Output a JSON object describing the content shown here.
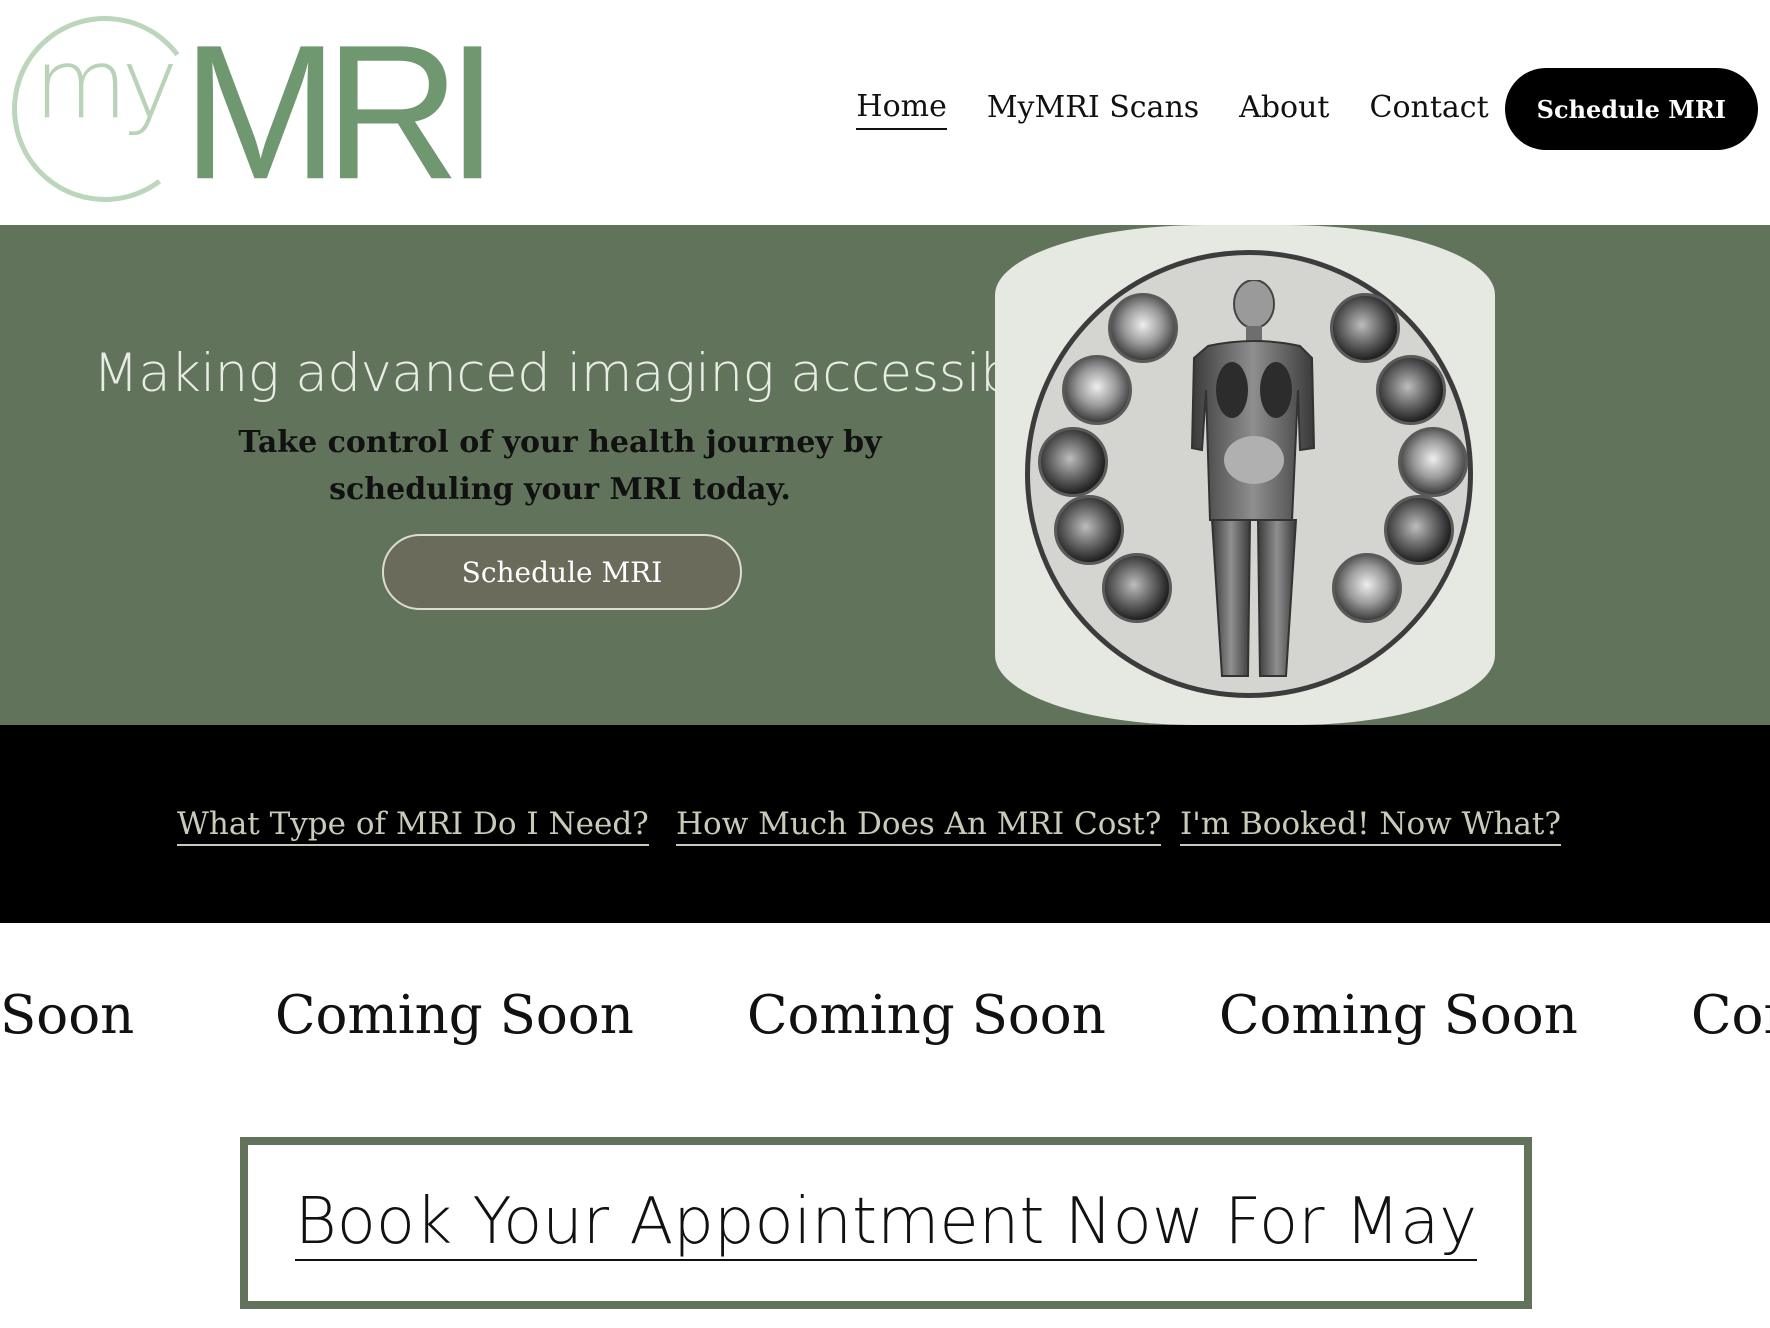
{
  "header": {
    "logo_my": "my",
    "logo_mri": "MRI",
    "nav": [
      {
        "label": "Home",
        "active": true
      },
      {
        "label": "MyMRI Scans"
      },
      {
        "label": "About"
      },
      {
        "label": "Contact"
      }
    ],
    "cta_label": "Schedule MRI"
  },
  "hero": {
    "title": "Making advanced imaging accessible",
    "subtitle": "Take control of your health journey by scheduling your MRI today.",
    "button_label": "Schedule MRI",
    "background_color": "#61745b"
  },
  "info_links": [
    "What Type of MRI Do I Need?",
    "How Much Does An MRI Cost?",
    "I'm Booked!   Now What?"
  ],
  "marquee": {
    "items": [
      "Soon",
      "Coming Soon",
      "Coming Soon",
      "Coming Soon",
      "Con"
    ]
  },
  "booking": {
    "label": "Book Your Appointment Now For May",
    "border_color": "#61745b"
  }
}
